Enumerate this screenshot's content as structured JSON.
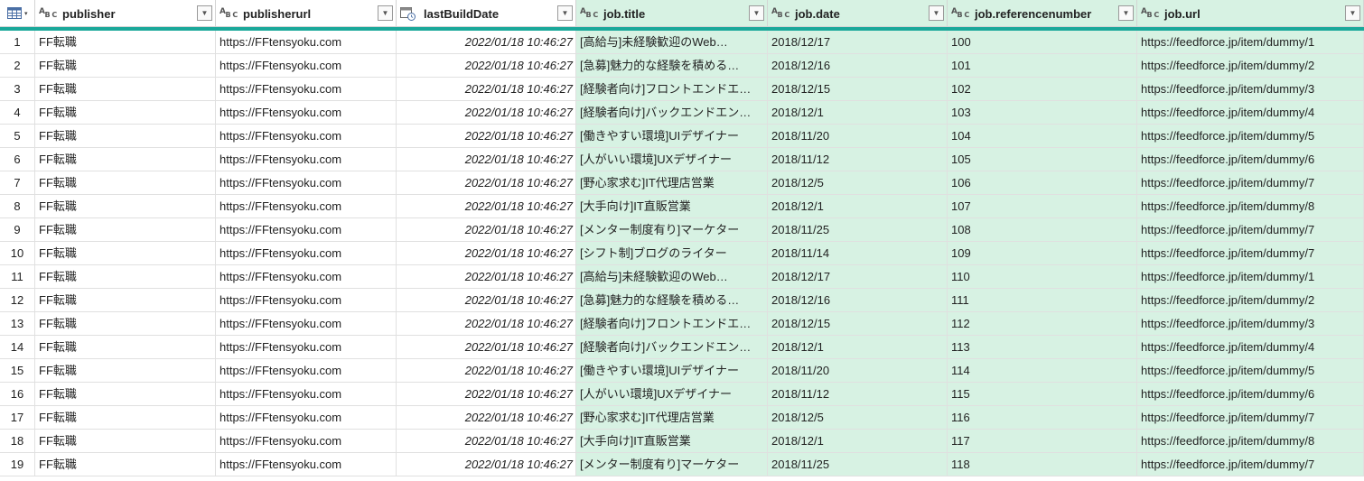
{
  "columns": [
    {
      "key": "publisher",
      "label": "publisher",
      "type_icon": "text-type-icon",
      "type_label": "A",
      "type_sub": "B C"
    },
    {
      "key": "publisherurl",
      "label": "publisherurl",
      "type_icon": "text-type-icon",
      "type_label": "A",
      "type_sub": "B C"
    },
    {
      "key": "lastBuildDate",
      "label": "lastBuildDate",
      "type_icon": "datetime-type-icon"
    },
    {
      "key": "job_title",
      "label": "job.title",
      "type_icon": "text-type-icon",
      "type_label": "A",
      "type_sub": "B C"
    },
    {
      "key": "job_date",
      "label": "job.date",
      "type_icon": "text-type-icon",
      "type_label": "A",
      "type_sub": "B C"
    },
    {
      "key": "job_referencenumber",
      "label": "job.referencenumber",
      "type_icon": "text-type-icon",
      "type_label": "A",
      "type_sub": "B C"
    },
    {
      "key": "job_url",
      "label": "job.url",
      "type_icon": "text-type-icon",
      "type_label": "A",
      "type_sub": "B C"
    }
  ],
  "filter_glyph": "▼",
  "corner_caret": "▾",
  "colors": {
    "accent": "#1aa89a",
    "selected": "#d7f2e3"
  },
  "rows": [
    {
      "n": "1",
      "publisher": "FF転職",
      "publisherurl": "https://FFtensyoku.com",
      "lastBuildDate": "2022/01/18 10:46:27",
      "job_title": "[高給与]未経験歓迎のWeb…",
      "job_date": "2018/12/17",
      "job_referencenumber": "100",
      "job_url": "https://feedforce.jp/item/dummy/1"
    },
    {
      "n": "2",
      "publisher": "FF転職",
      "publisherurl": "https://FFtensyoku.com",
      "lastBuildDate": "2022/01/18 10:46:27",
      "job_title": "[急募]魅力的な経験を積める…",
      "job_date": "2018/12/16",
      "job_referencenumber": "101",
      "job_url": "https://feedforce.jp/item/dummy/2"
    },
    {
      "n": "3",
      "publisher": "FF転職",
      "publisherurl": "https://FFtensyoku.com",
      "lastBuildDate": "2022/01/18 10:46:27",
      "job_title": "[経験者向け]フロントエンドエ…",
      "job_date": "2018/12/15",
      "job_referencenumber": "102",
      "job_url": "https://feedforce.jp/item/dummy/3"
    },
    {
      "n": "4",
      "publisher": "FF転職",
      "publisherurl": "https://FFtensyoku.com",
      "lastBuildDate": "2022/01/18 10:46:27",
      "job_title": "[経験者向け]バックエンドエン…",
      "job_date": "2018/12/1",
      "job_referencenumber": "103",
      "job_url": "https://feedforce.jp/item/dummy/4"
    },
    {
      "n": "5",
      "publisher": "FF転職",
      "publisherurl": "https://FFtensyoku.com",
      "lastBuildDate": "2022/01/18 10:46:27",
      "job_title": "[働きやすい環境]UIデザイナー",
      "job_date": "2018/11/20",
      "job_referencenumber": "104",
      "job_url": "https://feedforce.jp/item/dummy/5"
    },
    {
      "n": "6",
      "publisher": "FF転職",
      "publisherurl": "https://FFtensyoku.com",
      "lastBuildDate": "2022/01/18 10:46:27",
      "job_title": "[人がいい環境]UXデザイナー",
      "job_date": "2018/11/12",
      "job_referencenumber": "105",
      "job_url": "https://feedforce.jp/item/dummy/6"
    },
    {
      "n": "7",
      "publisher": "FF転職",
      "publisherurl": "https://FFtensyoku.com",
      "lastBuildDate": "2022/01/18 10:46:27",
      "job_title": "[野心家求む]IT代理店営業",
      "job_date": "2018/12/5",
      "job_referencenumber": "106",
      "job_url": "https://feedforce.jp/item/dummy/7"
    },
    {
      "n": "8",
      "publisher": "FF転職",
      "publisherurl": "https://FFtensyoku.com",
      "lastBuildDate": "2022/01/18 10:46:27",
      "job_title": "[大手向け]IT直販営業",
      "job_date": "2018/12/1",
      "job_referencenumber": "107",
      "job_url": "https://feedforce.jp/item/dummy/8"
    },
    {
      "n": "9",
      "publisher": "FF転職",
      "publisherurl": "https://FFtensyoku.com",
      "lastBuildDate": "2022/01/18 10:46:27",
      "job_title": "[メンター制度有り]マーケター",
      "job_date": "2018/11/25",
      "job_referencenumber": "108",
      "job_url": "https://feedforce.jp/item/dummy/7"
    },
    {
      "n": "10",
      "publisher": "FF転職",
      "publisherurl": "https://FFtensyoku.com",
      "lastBuildDate": "2022/01/18 10:46:27",
      "job_title": "[シフト制]ブログのライター",
      "job_date": "2018/11/14",
      "job_referencenumber": "109",
      "job_url": "https://feedforce.jp/item/dummy/7"
    },
    {
      "n": "11",
      "publisher": "FF転職",
      "publisherurl": "https://FFtensyoku.com",
      "lastBuildDate": "2022/01/18 10:46:27",
      "job_title": "[高給与]未経験歓迎のWeb…",
      "job_date": "2018/12/17",
      "job_referencenumber": "110",
      "job_url": "https://feedforce.jp/item/dummy/1"
    },
    {
      "n": "12",
      "publisher": "FF転職",
      "publisherurl": "https://FFtensyoku.com",
      "lastBuildDate": "2022/01/18 10:46:27",
      "job_title": "[急募]魅力的な経験を積める…",
      "job_date": "2018/12/16",
      "job_referencenumber": "111",
      "job_url": "https://feedforce.jp/item/dummy/2"
    },
    {
      "n": "13",
      "publisher": "FF転職",
      "publisherurl": "https://FFtensyoku.com",
      "lastBuildDate": "2022/01/18 10:46:27",
      "job_title": "[経験者向け]フロントエンドエ…",
      "job_date": "2018/12/15",
      "job_referencenumber": "112",
      "job_url": "https://feedforce.jp/item/dummy/3"
    },
    {
      "n": "14",
      "publisher": "FF転職",
      "publisherurl": "https://FFtensyoku.com",
      "lastBuildDate": "2022/01/18 10:46:27",
      "job_title": "[経験者向け]バックエンドエン…",
      "job_date": "2018/12/1",
      "job_referencenumber": "113",
      "job_url": "https://feedforce.jp/item/dummy/4"
    },
    {
      "n": "15",
      "publisher": "FF転職",
      "publisherurl": "https://FFtensyoku.com",
      "lastBuildDate": "2022/01/18 10:46:27",
      "job_title": "[働きやすい環境]UIデザイナー",
      "job_date": "2018/11/20",
      "job_referencenumber": "114",
      "job_url": "https://feedforce.jp/item/dummy/5"
    },
    {
      "n": "16",
      "publisher": "FF転職",
      "publisherurl": "https://FFtensyoku.com",
      "lastBuildDate": "2022/01/18 10:46:27",
      "job_title": "[人がいい環境]UXデザイナー",
      "job_date": "2018/11/12",
      "job_referencenumber": "115",
      "job_url": "https://feedforce.jp/item/dummy/6"
    },
    {
      "n": "17",
      "publisher": "FF転職",
      "publisherurl": "https://FFtensyoku.com",
      "lastBuildDate": "2022/01/18 10:46:27",
      "job_title": "[野心家求む]IT代理店営業",
      "job_date": "2018/12/5",
      "job_referencenumber": "116",
      "job_url": "https://feedforce.jp/item/dummy/7"
    },
    {
      "n": "18",
      "publisher": "FF転職",
      "publisherurl": "https://FFtensyoku.com",
      "lastBuildDate": "2022/01/18 10:46:27",
      "job_title": "[大手向け]IT直販営業",
      "job_date": "2018/12/1",
      "job_referencenumber": "117",
      "job_url": "https://feedforce.jp/item/dummy/8"
    },
    {
      "n": "19",
      "publisher": "FF転職",
      "publisherurl": "https://FFtensyoku.com",
      "lastBuildDate": "2022/01/18 10:46:27",
      "job_title": "[メンター制度有り]マーケター",
      "job_date": "2018/11/25",
      "job_referencenumber": "118",
      "job_url": "https://feedforce.jp/item/dummy/7"
    }
  ]
}
